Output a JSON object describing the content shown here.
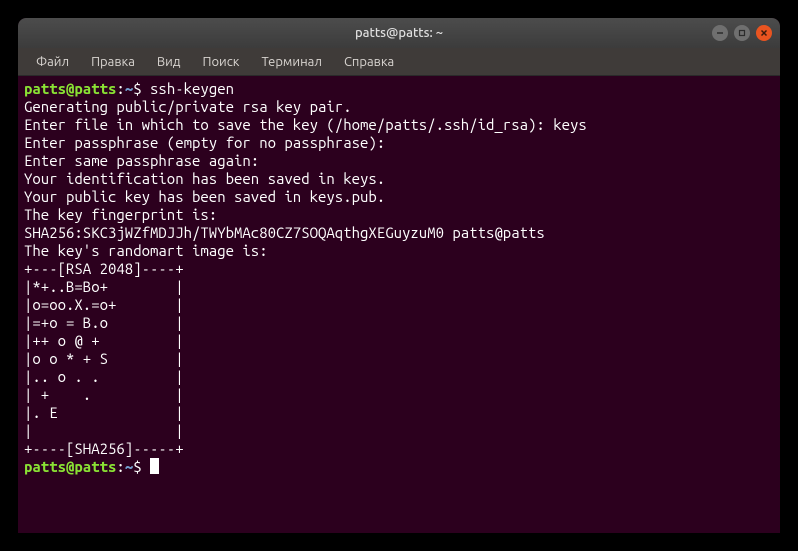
{
  "window": {
    "title": "patts@patts: ~"
  },
  "menu": {
    "items": [
      "Файл",
      "Правка",
      "Вид",
      "Поиск",
      "Терминал",
      "Справка"
    ]
  },
  "terminal": {
    "prompt_user": "patts@patts",
    "prompt_sep": ":",
    "prompt_path": "~",
    "prompt_end": "$ ",
    "command": "ssh-keygen",
    "lines": [
      "Generating public/private rsa key pair.",
      "Enter file in which to save the key (/home/patts/.ssh/id_rsa): keys",
      "Enter passphrase (empty for no passphrase):",
      "Enter same passphrase again:",
      "Your identification has been saved in keys.",
      "Your public key has been saved in keys.pub.",
      "The key fingerprint is:",
      "SHA256:SKC3jWZfMDJJh/TWYbMAc80CZ7SOQAqthgXEGuyzuM0 patts@patts",
      "The key's randomart image is:",
      "+---[RSA 2048]----+",
      "|*+..B=Bo+        |",
      "|o=oo.X.=o+       |",
      "|=+o = B.o        |",
      "|++ o @ +         |",
      "|o o * + S        |",
      "|.. o . .         |",
      "| +    .          |",
      "|. E              |",
      "|                 |",
      "+----[SHA256]-----+"
    ]
  }
}
